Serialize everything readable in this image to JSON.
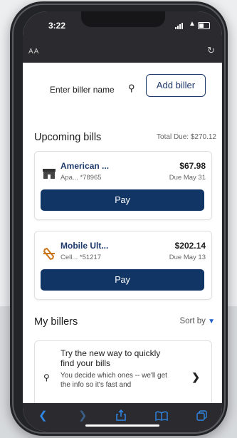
{
  "status": {
    "time": "3:22"
  },
  "browser": {
    "text_size_label": "AA",
    "reload_icon": "reload-icon"
  },
  "search": {
    "placeholder": "Enter biller name"
  },
  "add_biller": {
    "label": "Add biller"
  },
  "upcoming": {
    "title": "Upcoming bills",
    "total_due": "Total Due: $270.12",
    "bills": [
      {
        "name": "American ...",
        "amount": "$67.98",
        "account": "Apa... *78965",
        "due": "Due May 31",
        "pay_label": "Pay",
        "icon": "storefront-icon"
      },
      {
        "name": "Mobile Ult...",
        "amount": "$202.14",
        "account": "Cell... *51217",
        "due": "Due May 13",
        "pay_label": "Pay",
        "icon": "phone-icon"
      }
    ]
  },
  "my_billers": {
    "title": "My billers",
    "sort_label": "Sort by",
    "promo": {
      "title": "Try the new way to quickly find your bills",
      "body": "You decide which ones -- we'll get the info so it's fast and"
    }
  },
  "colors": {
    "primary": "#113666",
    "accent": "#1f5fc9",
    "toolbar": "#2b2b2f",
    "toolbar_icon": "#2f86e6"
  }
}
